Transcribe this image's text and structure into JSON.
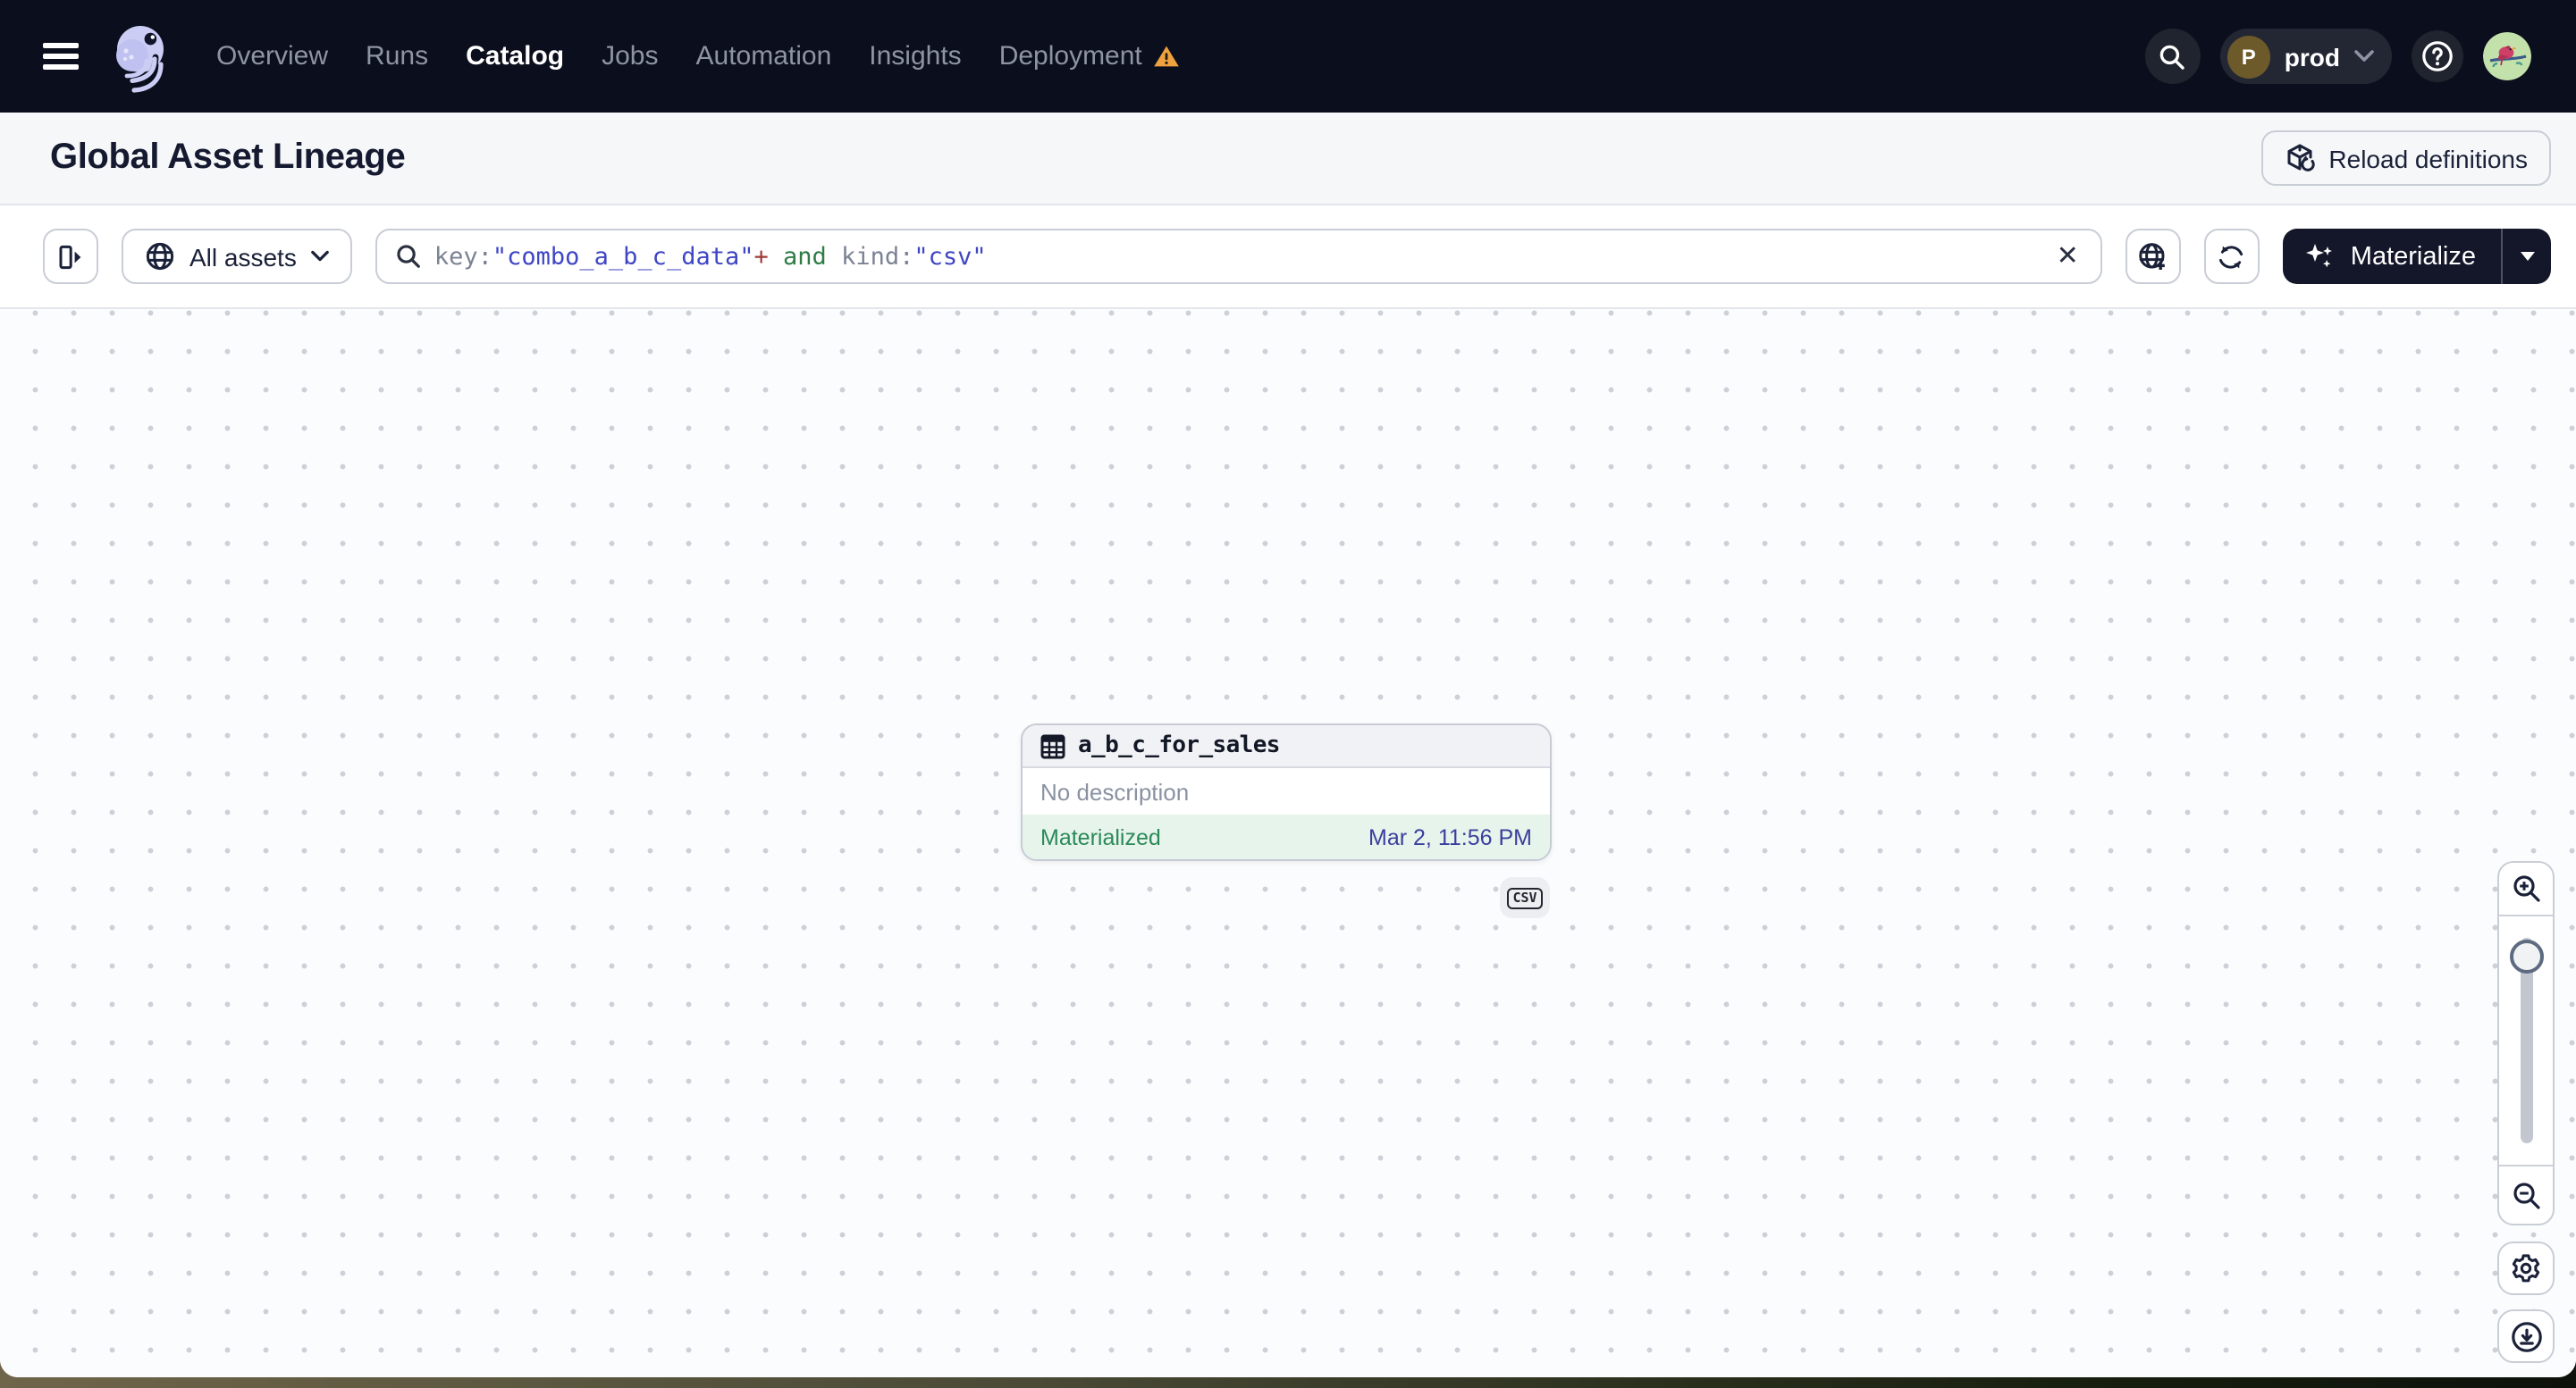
{
  "nav": {
    "items": [
      {
        "label": "Overview",
        "active": false,
        "warning": false
      },
      {
        "label": "Runs",
        "active": false,
        "warning": false
      },
      {
        "label": "Catalog",
        "active": true,
        "warning": false
      },
      {
        "label": "Jobs",
        "active": false,
        "warning": false
      },
      {
        "label": "Automation",
        "active": false,
        "warning": false
      },
      {
        "label": "Insights",
        "active": false,
        "warning": false
      },
      {
        "label": "Deployment",
        "active": false,
        "warning": true
      }
    ],
    "environment": {
      "initial": "P",
      "name": "prod"
    }
  },
  "page": {
    "title": "Global Asset Lineage",
    "reload_label": "Reload definitions"
  },
  "toolbar": {
    "scope_label": "All assets",
    "materialize_label": "Materialize",
    "query_tokens": [
      {
        "text": "key:",
        "type": "field"
      },
      {
        "text": "\"combo_a_b_c_data\"",
        "type": "string"
      },
      {
        "text": "+",
        "type": "operator"
      },
      {
        "text": " and ",
        "type": "keyword"
      },
      {
        "text": "kind:",
        "type": "field"
      },
      {
        "text": "\"csv\"",
        "type": "string"
      }
    ]
  },
  "graph": {
    "node": {
      "name": "a_b_c_for_sales",
      "description": "No description",
      "status": "Materialized",
      "materialized_at": "Mar 2, 11:56 PM",
      "kind_tag": "CSV"
    }
  },
  "colors": {
    "nav_bg": "#0b0e1c",
    "warning_orange": "#efa13f",
    "status_green": "#2b8a58",
    "status_row_bg": "#e7f4eb",
    "timestamp_blue": "#3b3f9d",
    "materialize_bg": "#131729",
    "query_field": "#7b8294",
    "query_string": "#3f46c4",
    "query_operator": "#9e3a3a",
    "query_keyword": "#2e7d44",
    "logo_lavender": "#cbcdf4",
    "env_avatar_brown": "#6d5a2b"
  }
}
